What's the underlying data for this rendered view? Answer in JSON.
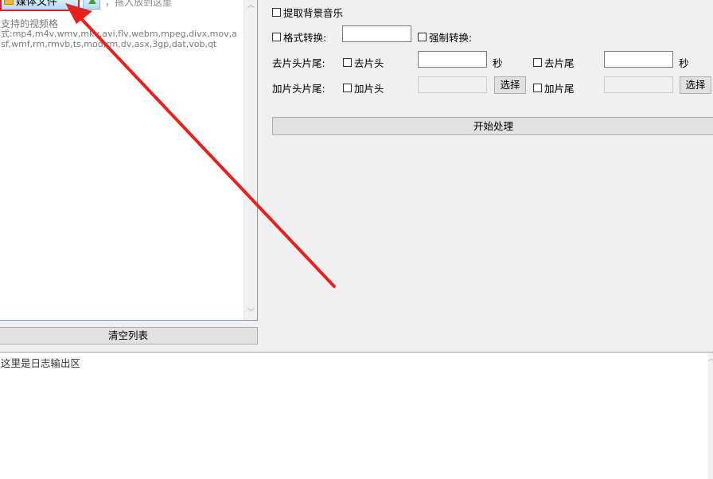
{
  "file_list": {
    "media_button_label": "媒体文件",
    "drag_hint": "，拖入放到这里",
    "formats_title": "支持的视频格",
    "formats_list": "式:mp4,m4v,wmv,mkv,avi,flv,webm,mpeg,divx,mov,asf,wmf,rm,rmvb,ts,mod,rm,dv,asx,3gp,dat,vob,qt",
    "clear_button_label": "清空列表"
  },
  "options": {
    "extract_bg_music": "提取背景音乐",
    "format_convert": "格式转换:",
    "force_convert": "强制转换:",
    "trim_label": "去片头片尾:",
    "trim_head": "去片头",
    "trim_tail": "去片尾",
    "seconds_unit": "秒",
    "add_label": "加片头片尾:",
    "add_head": "加片头",
    "add_tail": "加片尾",
    "select_button": "选择",
    "start_button": "开始处理"
  },
  "log": {
    "placeholder": "这里是日志输出区"
  },
  "colors": {
    "annotation_red": "#e82020",
    "panel_border": "#7a9ebf"
  }
}
